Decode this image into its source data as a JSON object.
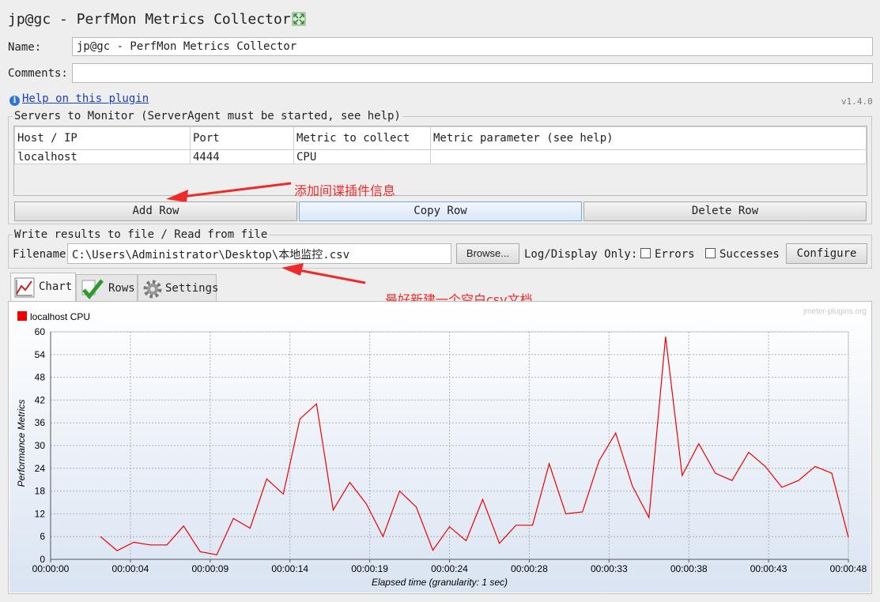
{
  "window": {
    "title": "jp@gc - PerfMon Metrics Collector",
    "title_icon": "expand-icon"
  },
  "form": {
    "name_label": "Name:",
    "name_value": "jp@gc - PerfMon Metrics Collector",
    "comments_label": "Comments:",
    "comments_value": "",
    "help_link": "Help on this plugin",
    "version": "v1.4.0"
  },
  "servers": {
    "legend": "Servers to Monitor (ServerAgent must be started, see help)",
    "columns": [
      "Host / IP",
      "Port",
      "Metric to collect",
      "Metric parameter (see help)"
    ],
    "rows": [
      [
        "localhost",
        "4444",
        "CPU",
        ""
      ]
    ],
    "buttons": {
      "add": "Add Row",
      "copy": "Copy Row",
      "delete": "Delete Row"
    }
  },
  "file": {
    "legend": "Write results to file / Read from file",
    "filename_label": "Filename",
    "filename_value": "C:\\Users\\Administrator\\Desktop\\本地监控.csv",
    "browse": "Browse...",
    "log_label": "Log/Display Only:",
    "errors_label": "Errors",
    "successes_label": "Successes",
    "errors_checked": false,
    "successes_checked": false,
    "configure": "Configure"
  },
  "annotations": {
    "add_row_note": "添加间谍插件信息",
    "file_note": "最好新建一个空白csv文档",
    "color": "#ee2a2a"
  },
  "tabs": [
    {
      "label": "Chart",
      "icon": "chart-icon",
      "active": true
    },
    {
      "label": "Rows",
      "icon": "checkmark-icon",
      "active": false
    },
    {
      "label": "Settings",
      "icon": "gear-icon",
      "active": false
    }
  ],
  "chart_watermark": "jmeter-plugins.org",
  "chart_data": {
    "type": "line",
    "xlabel": "Elapsed time (granularity: 1 sec)",
    "ylabel": "Performance Metrics",
    "ylim": [
      0,
      60
    ],
    "yticks": [
      0,
      6,
      12,
      18,
      24,
      30,
      36,
      42,
      48,
      54,
      60
    ],
    "xlim_sec": [
      0,
      48
    ],
    "xticks": [
      "00:00:00",
      "00:00:04",
      "00:00:09",
      "00:00:14",
      "00:00:19",
      "00:00:24",
      "00:00:28",
      "00:00:33",
      "00:00:38",
      "00:00:43",
      "00:00:48"
    ],
    "grid": true,
    "legend_position": "top-left",
    "series": [
      {
        "name": "localhost CPU",
        "color": "#ee0000",
        "x": [
          3,
          4,
          5,
          6,
          7,
          8,
          9,
          10,
          11,
          12,
          13,
          14,
          15,
          16,
          17,
          18,
          19,
          20,
          21,
          22,
          23,
          24,
          25,
          26,
          27,
          28,
          29,
          30,
          31,
          32,
          33,
          34,
          35,
          36,
          37,
          38,
          39,
          40,
          41,
          42,
          43,
          44,
          45,
          46,
          47,
          48
        ],
        "values": [
          6,
          2.3,
          4.5,
          3.8,
          3.8,
          8.8,
          2,
          1.2,
          10.8,
          8.2,
          21.2,
          17.2,
          37,
          41,
          13,
          20.3,
          14.6,
          6,
          18,
          13.8,
          2.4,
          8.6,
          4.9,
          15.8,
          4.2,
          9,
          9,
          25.2,
          12,
          12.5,
          26,
          33.3,
          19.4,
          11,
          58.7,
          22.1,
          30.5,
          22.7,
          20.8,
          28.2,
          24.5,
          19,
          20.8,
          24.5,
          22.7,
          5.8
        ]
      }
    ]
  }
}
